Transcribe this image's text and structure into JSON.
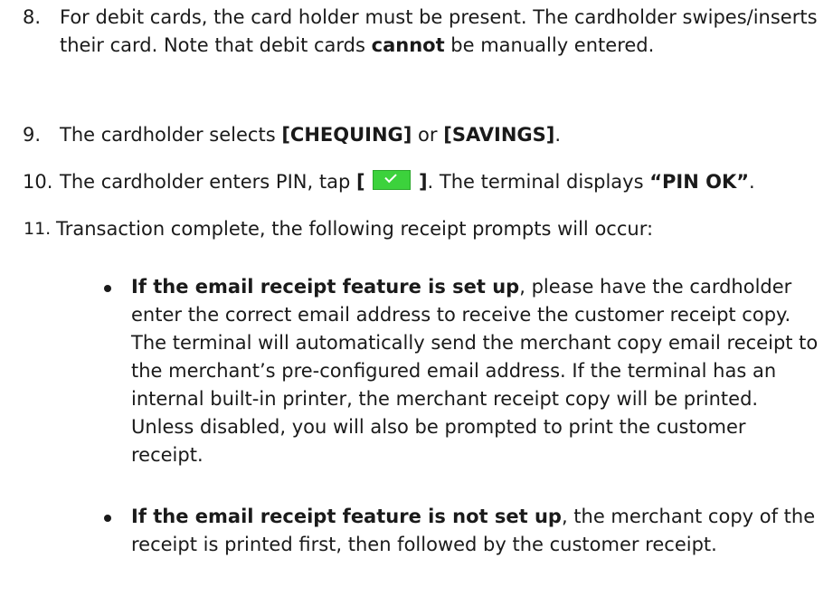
{
  "steps": [
    {
      "number": "8.",
      "part1": "For debit cards, the card holder must be present. The cardholder swipes/inserts their card. Note that debit cards ",
      "bold1": "cannot",
      "part2": " be manually entered."
    },
    {
      "number": "9.",
      "part1": "The cardholder selects ",
      "bold1": "[CHEQUING]",
      "part2": " or ",
      "bold2": "[SAVINGS]",
      "part3": "."
    },
    {
      "number": "10.",
      "part1": "The cardholder enters PIN, tap ",
      "bold_open": "[",
      "bold_close": "]",
      "part2": ".  The terminal displays ",
      "bold2": "“PIN OK”",
      "part3": "."
    },
    {
      "number": "11.",
      "text": "Transaction complete, the following receipt prompts will occur:"
    }
  ],
  "bullets": [
    {
      "bold": "If the email receipt feature is set up",
      "text": ", please have the cardholder enter the correct email address to receive the customer receipt copy.  The terminal will automatically send the merchant copy email receipt to the merchant’s pre-configured email address. If the terminal has an internal built-in printer, the merchant receipt copy will be printed. Unless disabled, you will also be prompted to print the customer receipt."
    },
    {
      "bold": "If the email receipt feature is not set up",
      "text": ", the merchant copy of the receipt is printed first, then followed by the customer receipt."
    }
  ],
  "colors": {
    "text": "#1a1a1a",
    "check_button": "#3cd23c"
  },
  "icons": {
    "confirm_button": "check-icon"
  }
}
